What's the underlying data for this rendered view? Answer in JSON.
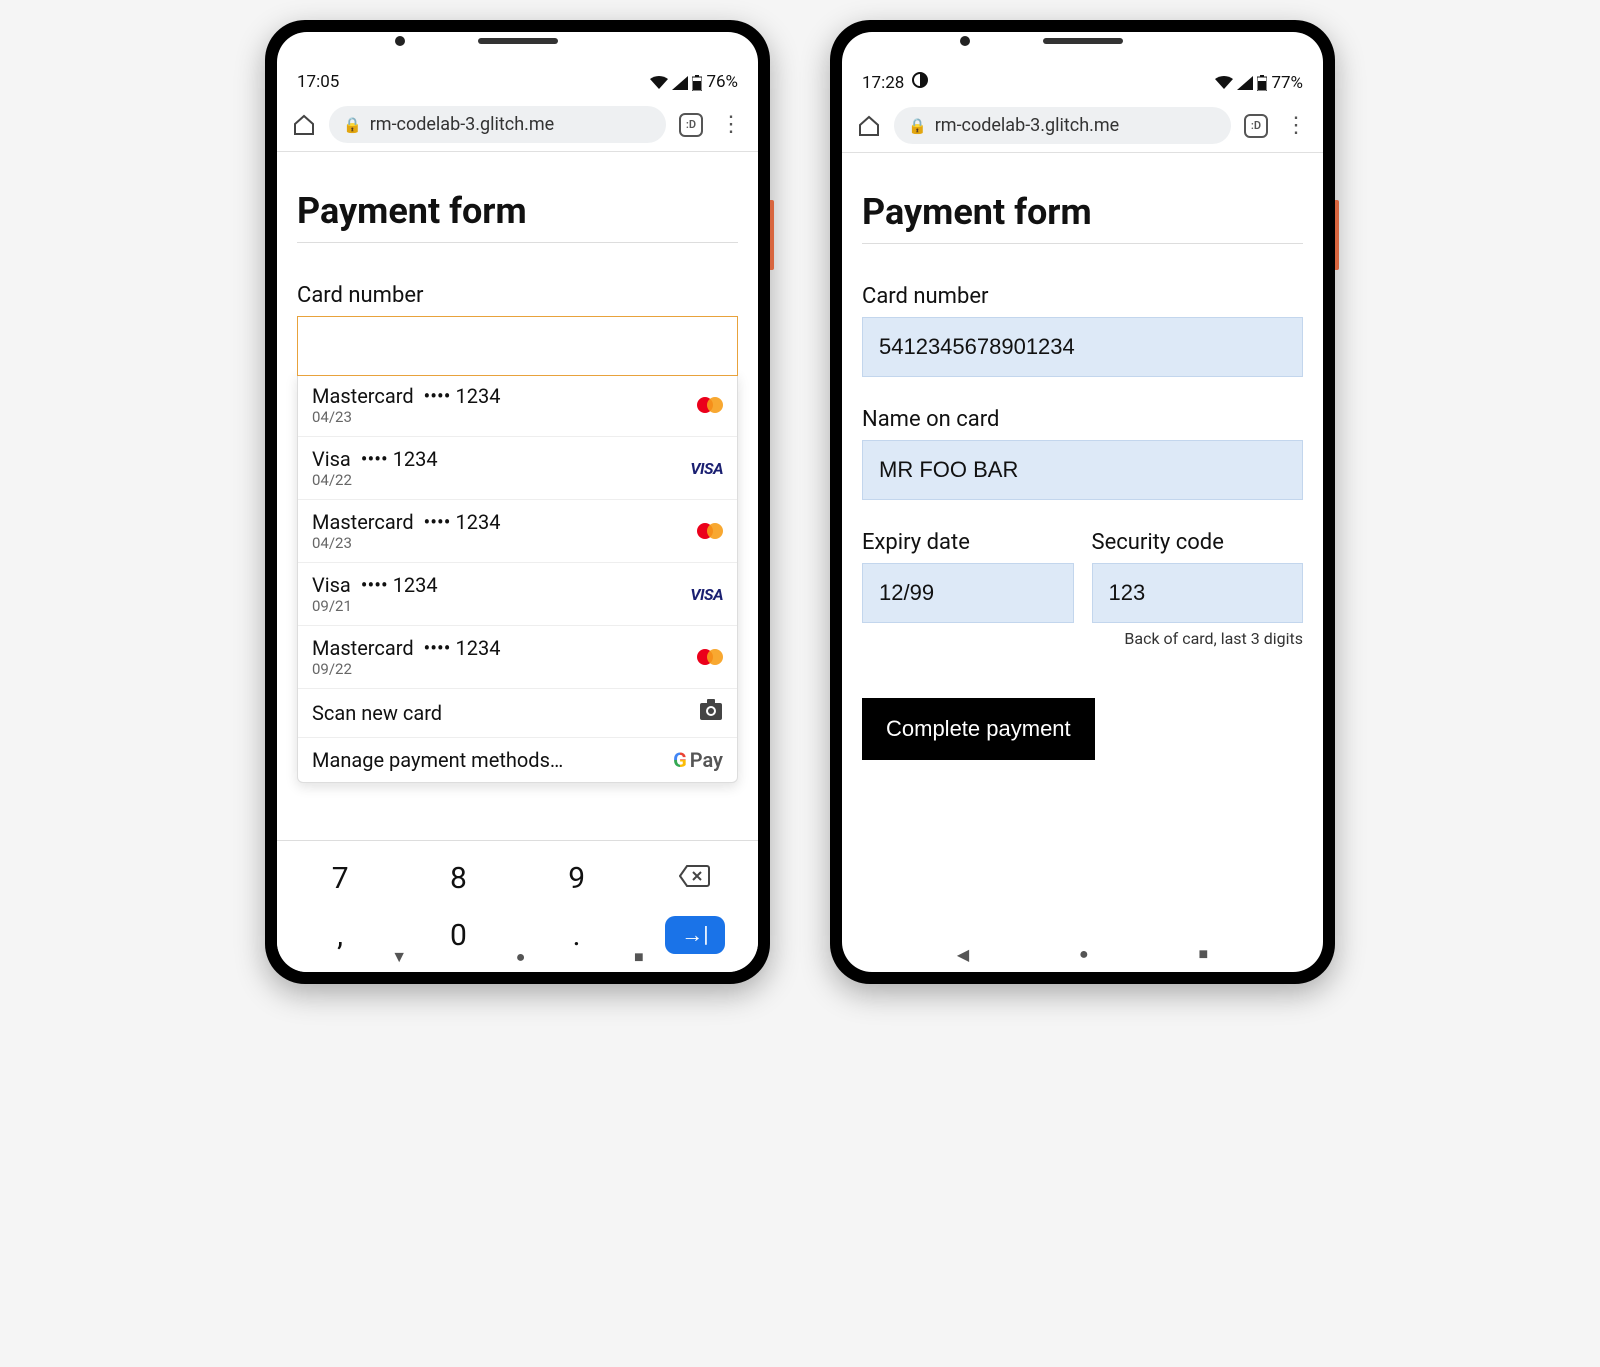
{
  "phone1": {
    "statusbar": {
      "time": "17:05",
      "battery": "76%",
      "has_datasaver": false
    },
    "browser": {
      "url": "rm-codelab-3.glitch.me",
      "tab_label": ":D"
    },
    "title": "Payment form",
    "fields": {
      "card_number_label": "Card number",
      "card_number_value": ""
    },
    "autofill": [
      {
        "brand": "Mastercard",
        "mask": "•••• 1234",
        "exp": "04/23",
        "logo": "mastercard"
      },
      {
        "brand": "Visa",
        "mask": "•••• 1234",
        "exp": "04/22",
        "logo": "visa"
      },
      {
        "brand": "Mastercard",
        "mask": "•••• 1234",
        "exp": "04/23",
        "logo": "mastercard"
      },
      {
        "brand": "Visa",
        "mask": "•••• 1234",
        "exp": "09/21",
        "logo": "visa"
      },
      {
        "brand": "Mastercard",
        "mask": "•••• 1234",
        "exp": "09/22",
        "logo": "mastercard"
      }
    ],
    "autofill_actions": {
      "scan": "Scan new card",
      "manage": "Manage payment methods…",
      "gpay_label": "Pay"
    },
    "keypad": {
      "row1": [
        "7",
        "8",
        "9"
      ],
      "row2": [
        ",",
        "0",
        "."
      ]
    }
  },
  "phone2": {
    "statusbar": {
      "time": "17:28",
      "battery": "77%",
      "has_datasaver": true
    },
    "browser": {
      "url": "rm-codelab-3.glitch.me",
      "tab_label": ":D"
    },
    "title": "Payment form",
    "fields": {
      "card_number_label": "Card number",
      "card_number_value": "5412345678901234",
      "name_label": "Name on card",
      "name_value": "MR FOO BAR",
      "expiry_label": "Expiry date",
      "expiry_value": "12/99",
      "cvc_label": "Security code",
      "cvc_value": "123",
      "cvc_hint": "Back of card, last 3 digits"
    },
    "submit": "Complete payment"
  }
}
